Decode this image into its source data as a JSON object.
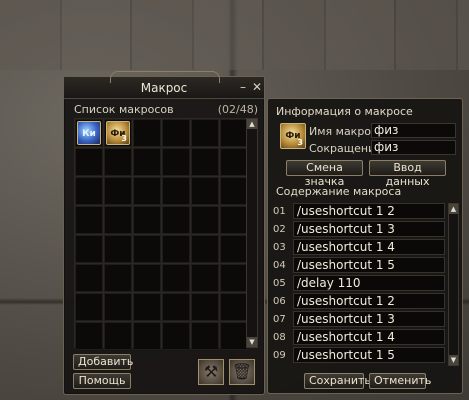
{
  "macro_window": {
    "title": "Макрос",
    "list_label": "Список макросов",
    "count": "(02/48)",
    "macros": [
      {
        "text": "Ки",
        "num": "",
        "style": "ki"
      },
      {
        "text": "Фи",
        "num": "3",
        "style": "fiz"
      }
    ],
    "add_label": "Добавить",
    "help_label": "Помощь"
  },
  "info_window": {
    "section_title": "Информация о макросе",
    "icon_text": "Фи",
    "icon_num": "3",
    "name_label": "Имя макроса",
    "name_value": "физ",
    "short_label": "Сокращение",
    "short_value": "физ",
    "change_icon_label": "Смена значка",
    "enter_data_label": "Ввод данных",
    "content_title": "Содержание макроса",
    "lines": [
      {
        "num": "01",
        "cmd": "/useshortcut 1 2"
      },
      {
        "num": "02",
        "cmd": "/useshortcut 1 3"
      },
      {
        "num": "03",
        "cmd": "/useshortcut 1 4"
      },
      {
        "num": "04",
        "cmd": "/useshortcut 1 5"
      },
      {
        "num": "05",
        "cmd": "/delay 110"
      },
      {
        "num": "06",
        "cmd": "/useshortcut 1 2"
      },
      {
        "num": "07",
        "cmd": "/useshortcut 1 3"
      },
      {
        "num": "08",
        "cmd": "/useshortcut 1 4"
      },
      {
        "num": "09",
        "cmd": "/useshortcut 1 5"
      }
    ],
    "save_label": "Сохранить",
    "cancel_label": "Отменить"
  }
}
